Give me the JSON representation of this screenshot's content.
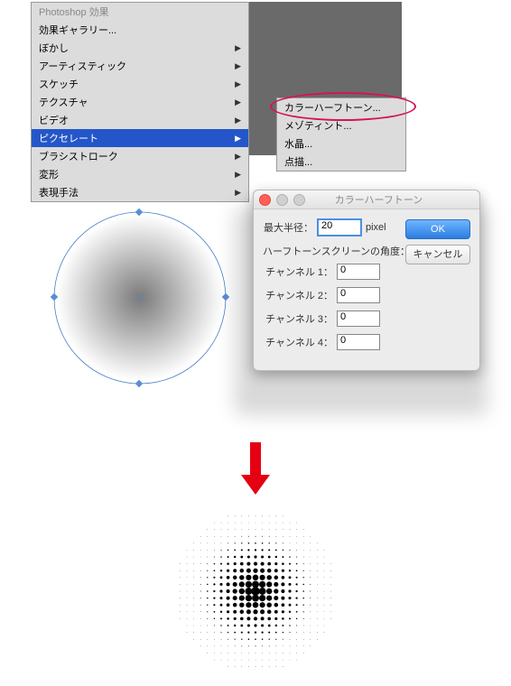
{
  "menu": {
    "title": "Photoshop 効果",
    "items": [
      {
        "label": "効果ギャラリー...",
        "arrow": false
      },
      {
        "label": "ぼかし",
        "arrow": true
      },
      {
        "label": "アーティスティック",
        "arrow": true
      },
      {
        "label": "スケッチ",
        "arrow": true
      },
      {
        "label": "テクスチャ",
        "arrow": true
      },
      {
        "label": "ビデオ",
        "arrow": true
      },
      {
        "label": "ピクセレート",
        "arrow": true,
        "highlighted": true
      },
      {
        "label": "ブラシストローク",
        "arrow": true
      },
      {
        "label": "変形",
        "arrow": true
      },
      {
        "label": "表現手法",
        "arrow": true
      }
    ],
    "submenu": [
      {
        "label": "カラーハーフトーン..."
      },
      {
        "label": "メゾティント..."
      },
      {
        "label": "水晶..."
      },
      {
        "label": "点描..."
      }
    ]
  },
  "dialog": {
    "title": "カラーハーフトーン",
    "maxRadius": {
      "label": "最大半径：",
      "value": "20",
      "unit": "pixel"
    },
    "screenAngleLabel": "ハーフトーンスクリーンの角度：",
    "channels": [
      {
        "label": "チャンネル 1：",
        "value": "0"
      },
      {
        "label": "チャンネル 2：",
        "value": "0"
      },
      {
        "label": "チャンネル 3：",
        "value": "0"
      },
      {
        "label": "チャンネル 4：",
        "value": "0"
      }
    ],
    "okLabel": "OK",
    "cancelLabel": "キャンセル"
  }
}
